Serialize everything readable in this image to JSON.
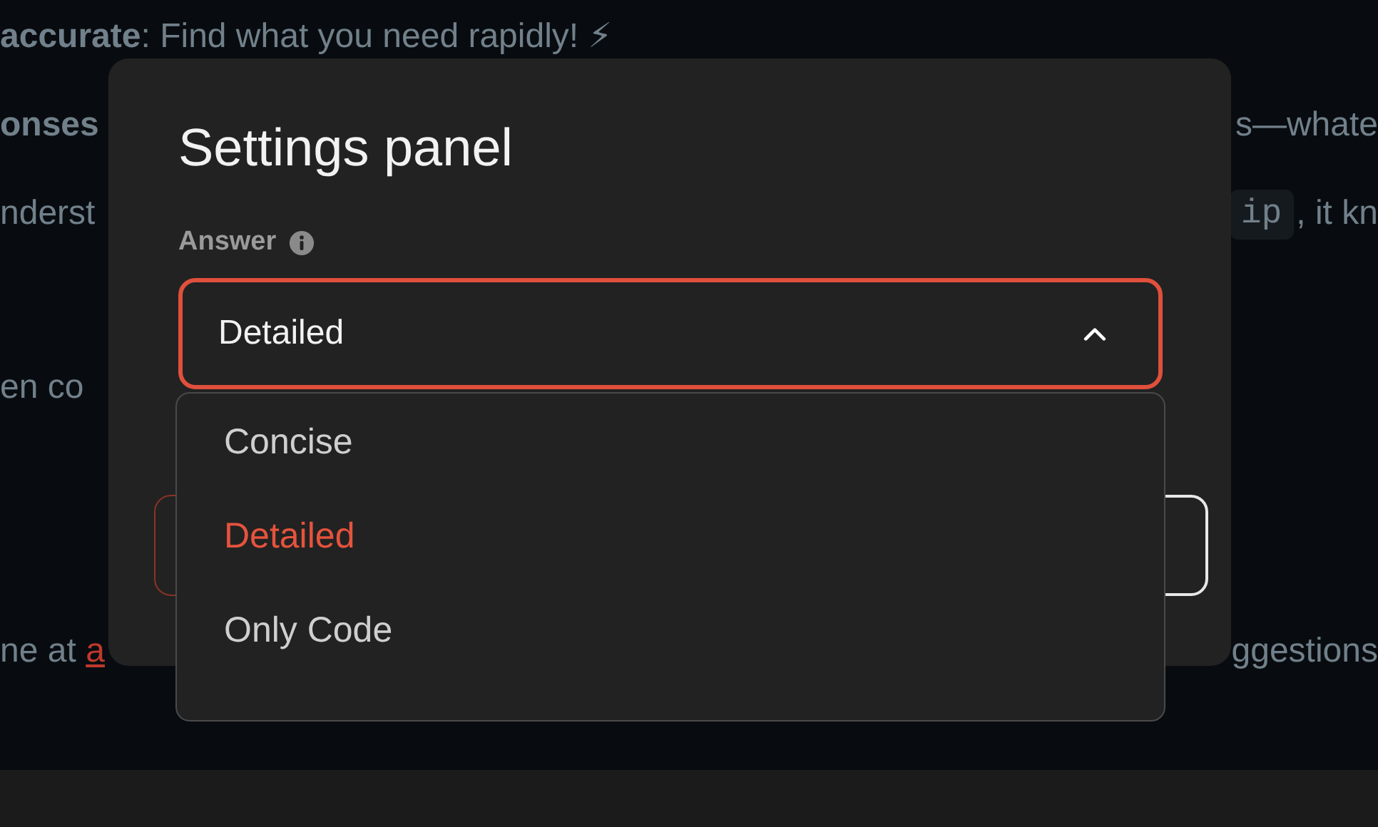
{
  "background": {
    "lines": [
      {
        "left": "**accurate**: Find what you need rapidly! ⚡"
      },
      {
        "left": "onses",
        "left_bold": true,
        "right": "s—whate"
      },
      {
        "left": "nderst",
        "code": "ip",
        "right": ", it kn"
      },
      {
        "left": "en co"
      },
      {
        "left": "ne at ",
        "link": "a",
        "right": "ggestions"
      }
    ],
    "buttons": [
      {
        "kind": "cancel"
      },
      {
        "kind": "confirm"
      }
    ]
  },
  "dialog": {
    "title": "Settings panel",
    "field": {
      "label": "Answer",
      "value": "Detailed",
      "expanded": true,
      "options": [
        {
          "label": "Concise",
          "selected": false
        },
        {
          "label": "Detailed",
          "selected": true
        },
        {
          "label": "Only Code",
          "selected": false
        }
      ]
    }
  }
}
